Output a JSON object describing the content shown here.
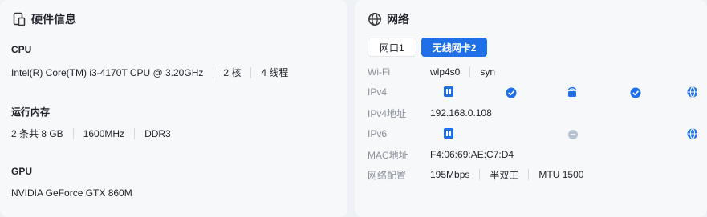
{
  "hardware": {
    "title": "硬件信息",
    "cpu": {
      "title": "CPU",
      "model": "Intel(R) Core(TM) i3-4170T CPU @ 3.20GHz",
      "cores": "2 核",
      "threads": "4 线程"
    },
    "memory": {
      "title": "运行内存",
      "size": "2 条共 8 GB",
      "frequency": "1600MHz",
      "type": "DDR3"
    },
    "gpu": {
      "title": "GPU",
      "model": "NVIDIA GeForce GTX 860M"
    }
  },
  "network": {
    "title": "网络",
    "tabs": [
      {
        "label": "网口1",
        "active": false
      },
      {
        "label": "无线网卡2",
        "active": true
      }
    ],
    "wifi": {
      "label": "Wi-Fi",
      "interface": "wlp4s0",
      "ssid": "syn"
    },
    "ipv4": {
      "label": "IPv4"
    },
    "ipv4_address": {
      "label": "IPv4地址",
      "value": "192.168.0.108"
    },
    "ipv6": {
      "label": "IPv6"
    },
    "mac": {
      "label": "MAC地址",
      "value": "F4:06:69:AE:C7:D4"
    },
    "config": {
      "label": "网络配置",
      "speed": "195Mbps",
      "duplex": "半双工",
      "mtu": "MTU 1500"
    }
  },
  "colors": {
    "accent": "#1e6fe8",
    "inactive_dot": "#b7c2d0",
    "line": "#c9d6ea"
  }
}
